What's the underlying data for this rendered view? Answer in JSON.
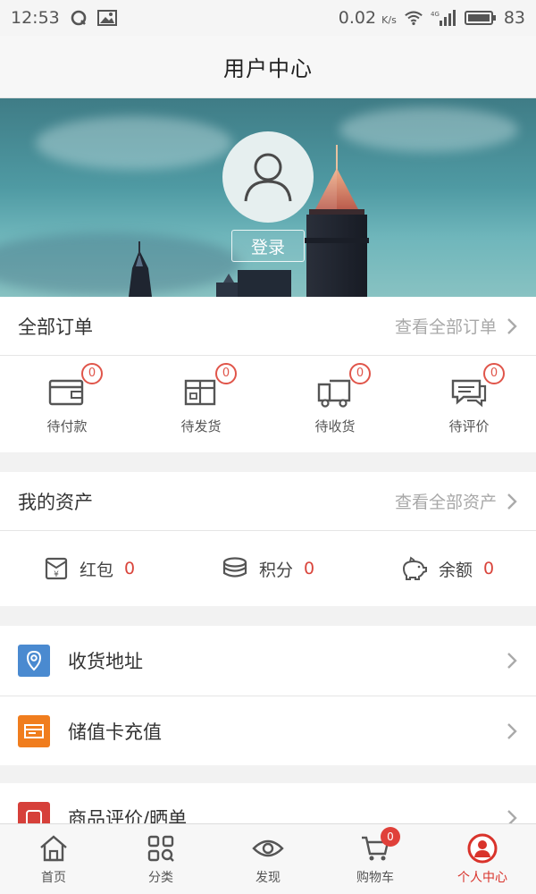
{
  "status_bar": {
    "time": "12:53",
    "net_speed": "0.02",
    "net_unit": "K/s",
    "network_type": "4G",
    "battery": "83"
  },
  "header": {
    "title": "用户中心"
  },
  "profile": {
    "login_label": "登录"
  },
  "orders": {
    "title": "全部订单",
    "view_all": "查看全部订单",
    "items": [
      {
        "label": "待付款",
        "count": "0",
        "icon": "wallet-icon"
      },
      {
        "label": "待发货",
        "count": "0",
        "icon": "package-icon"
      },
      {
        "label": "待收货",
        "count": "0",
        "icon": "delivery-truck-icon"
      },
      {
        "label": "待评价",
        "count": "0",
        "icon": "comment-icon"
      }
    ]
  },
  "assets": {
    "title": "我的资产",
    "view_all": "查看全部资产",
    "items": [
      {
        "label": "红包",
        "value": "0",
        "icon": "red-envelope-icon"
      },
      {
        "label": "积分",
        "value": "0",
        "icon": "coins-icon"
      },
      {
        "label": "余额",
        "value": "0",
        "icon": "piggy-bank-icon"
      }
    ]
  },
  "menu_group_1": [
    {
      "label": "收货地址",
      "icon": "location-pin-icon",
      "color": "#4a8ad0"
    },
    {
      "label": "储值卡充值",
      "icon": "card-icon",
      "color": "#f07d1e"
    }
  ],
  "menu_group_2": [
    {
      "label": "商品评价/晒单",
      "icon": "review-icon",
      "color": "#d6403a"
    }
  ],
  "bottom_nav": {
    "items": [
      {
        "label": "首页",
        "icon": "home-icon"
      },
      {
        "label": "分类",
        "icon": "category-grid-icon"
      },
      {
        "label": "发现",
        "icon": "eye-icon"
      },
      {
        "label": "购物车",
        "icon": "cart-icon",
        "badge": "0"
      },
      {
        "label": "个人中心",
        "icon": "user-circle-icon",
        "active": true
      }
    ]
  },
  "colors": {
    "accent": "#d9332b",
    "badge_outline": "#e0554a"
  }
}
